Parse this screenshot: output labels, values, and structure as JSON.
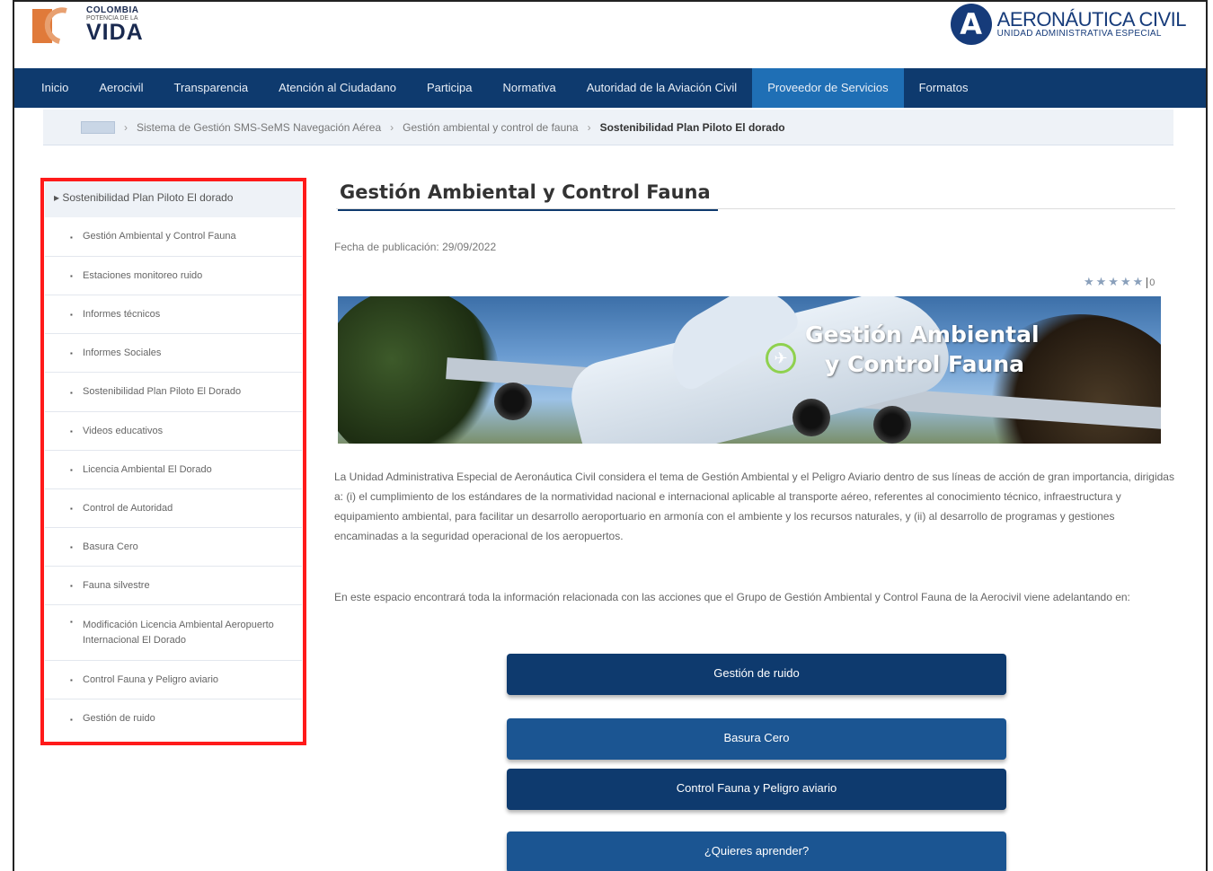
{
  "header": {
    "left_logo": {
      "line1": "COLOMBIA",
      "line2": "POTENCIA DE LA",
      "line3": "VIDA"
    },
    "right_logo": {
      "mark": "A",
      "title": "AERONÁUTICA CIVIL",
      "subtitle": "UNIDAD ADMINISTRATIVA ESPECIAL"
    }
  },
  "nav": {
    "items": [
      {
        "label": "Inicio"
      },
      {
        "label": "Aerocivil"
      },
      {
        "label": "Transparencia"
      },
      {
        "label": "Atención al Ciudadano"
      },
      {
        "label": "Participa"
      },
      {
        "label": "Normativa"
      },
      {
        "label": "Autoridad de la Aviación Civil"
      },
      {
        "label": "Proveedor de Servicios",
        "active": true
      },
      {
        "label": "Formatos"
      }
    ]
  },
  "breadcrumb": {
    "items": [
      "Sistema de Gestión SMS-SeMS Navegación Aérea",
      "Gestión ambiental y control de fauna",
      "Sostenibilidad Plan Piloto El dorado"
    ]
  },
  "sidebar": {
    "header": "Sostenibilidad Plan Piloto El dorado",
    "items": [
      {
        "label": "Gestión Ambiental y Control Fauna"
      },
      {
        "label": "Estaciones monitoreo ruido"
      },
      {
        "label": "Informes técnicos"
      },
      {
        "label": "Informes Sociales"
      },
      {
        "label": "Sostenibilidad Plan Piloto El Dorado"
      },
      {
        "label": "Videos educativos"
      },
      {
        "label": "Licencia Ambiental El Dorado"
      },
      {
        "label": "Control de Autoridad"
      },
      {
        "label": "Basura Cero"
      },
      {
        "label": "Fauna silvestre"
      },
      {
        "label": "Modificación Licencia Ambiental Aeropuerto Internacional El Dorado"
      },
      {
        "label": "Control Fauna y Peligro aviario"
      },
      {
        "label": "Gestión de ruido"
      }
    ]
  },
  "main": {
    "title": "Gestión Ambiental y Control Fauna",
    "pub_date": "Fecha de publicación: 29/09/2022",
    "rating": {
      "stars": "★★★★★",
      "count": "0"
    },
    "banner": {
      "line1": "Gestión Ambiental",
      "line2": "y Control Fauna",
      "icon": "plane-leaf-icon"
    },
    "paragraph1": "La Unidad Administrativa Especial de Aeronáutica Civil considera el tema de Gestión Ambiental y el Peligro Aviario dentro de sus líneas de acción de gran importancia, dirigidas a: (i) el cumplimiento de los estándares de la normatividad nacional e internacional aplicable al transporte aéreo, referentes al conocimiento técnico, infraestructura y equipamiento ambiental, para facilitar un desarrollo aeroportuario en armonía con el ambiente y los recursos naturales, y (ii) al desarrollo de programas y gestiones encaminadas a la seguridad operacional de los aeropuertos.",
    "paragraph2": "En este espacio encontrará toda la información relacionada con las acciones que el Grupo de Gestión Ambiental y Control Fauna de la Aerocivil viene adelantando en:",
    "buttons": [
      {
        "label": "Gestión de ruido"
      },
      {
        "label": "Basura Cero"
      },
      {
        "label": "Control Fauna y Peligro aviario"
      },
      {
        "label": "¿Quieres aprender?"
      }
    ]
  },
  "colors": {
    "nav_bg": "#0e3a6e",
    "nav_active": "#1f6fb5",
    "highlight_box": "#ff1a1a"
  }
}
